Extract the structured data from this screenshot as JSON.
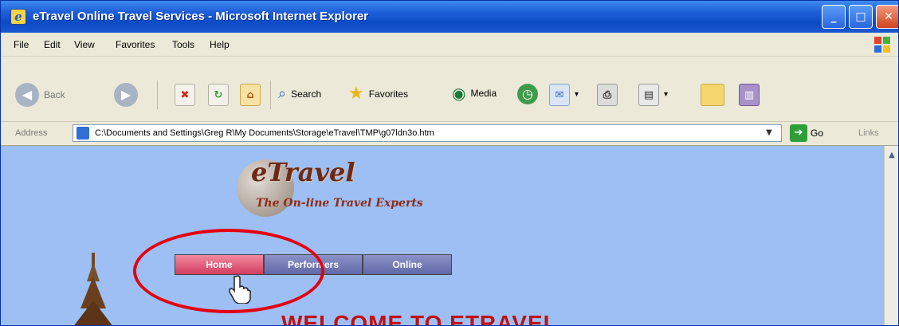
{
  "window": {
    "title": "eTravel Online Travel Services - Microsoft Internet Explorer"
  },
  "menu": {
    "items": [
      "File",
      "Edit",
      "View",
      "Favorites",
      "Tools",
      "Help"
    ]
  },
  "toolbar": {
    "back_label": "Back",
    "search_label": "Search",
    "favorites_label": "Favorites",
    "media_label": "Media"
  },
  "address": {
    "label": "Address",
    "url": "C:\\Documents and Settings\\Greg R\\My Documents\\Storage\\eTravel\\TMP\\g07ldn3o.htm",
    "go_label": "Go",
    "links_label": "Links"
  },
  "page": {
    "logo_title": "eTravel",
    "logo_subtitle": "The On-line Travel Experts",
    "nav": {
      "home": "Home",
      "performers": "Performers",
      "online": "Online"
    },
    "welcome": "WELCOME TO ETRAVEL"
  },
  "colors": {
    "titlebar": "#1f5fd9",
    "page_background": "#9dbff3",
    "highlight": "#e3000f",
    "welcome_text": "#c01010"
  }
}
